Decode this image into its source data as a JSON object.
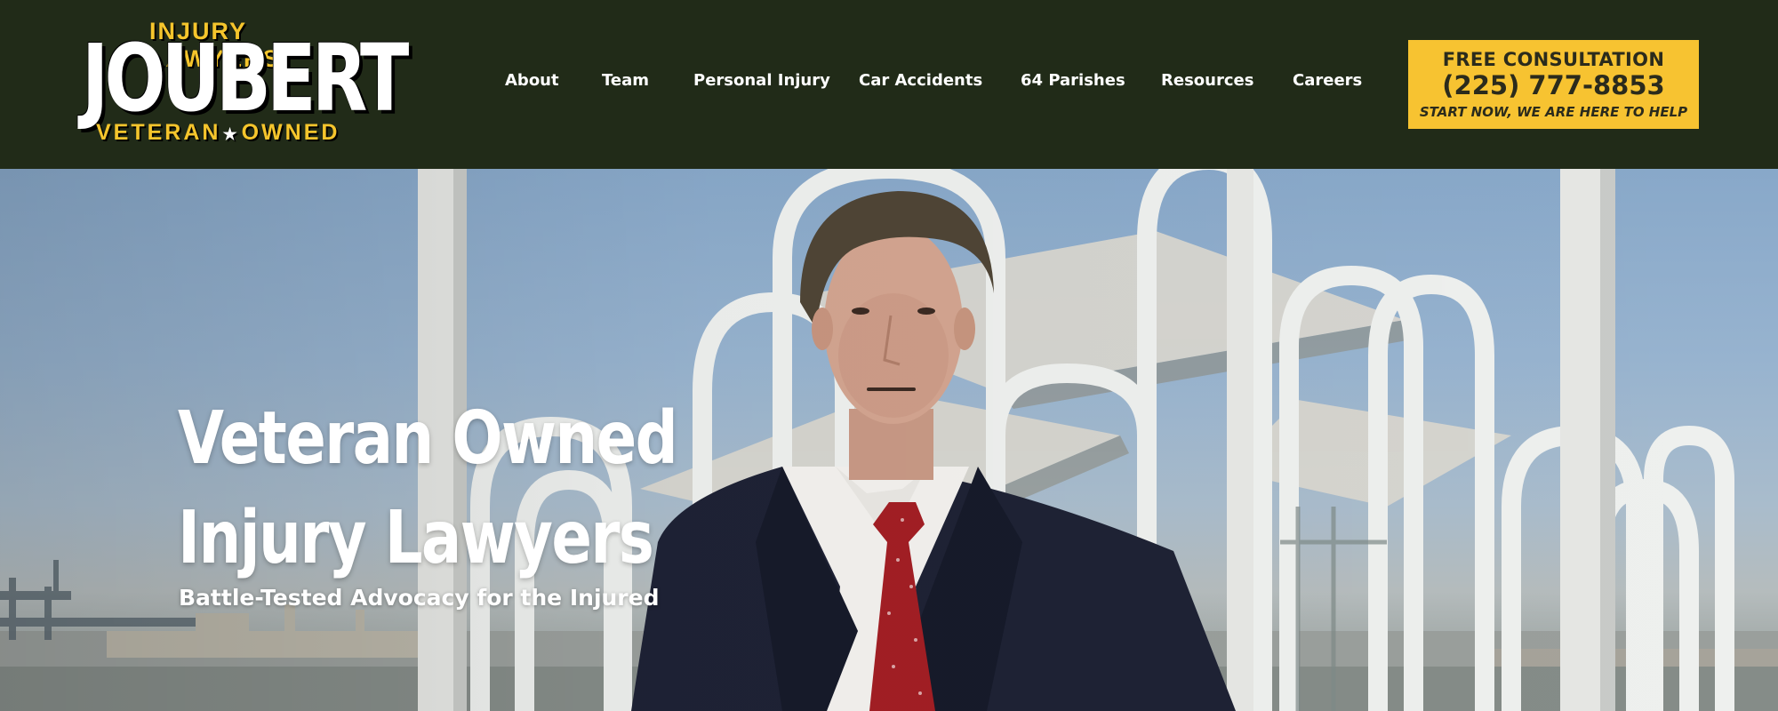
{
  "logo": {
    "top": "INJURY LAWYERS",
    "main": "JOUBERT",
    "bottom_left": "VETERAN",
    "bottom_right": "OWNED",
    "star_icon": "star-icon"
  },
  "nav": {
    "items": [
      {
        "label": "About"
      },
      {
        "label": "Team"
      },
      {
        "label": "Personal Injury"
      },
      {
        "label": "Car Accidents"
      },
      {
        "label": "64 Parishes"
      },
      {
        "label": "Resources"
      },
      {
        "label": "Careers"
      }
    ]
  },
  "cta": {
    "title": "FREE CONSULTATION",
    "phone": "(225) 777-8853",
    "subtitle": "START NOW, WE ARE HERE TO HELP"
  },
  "hero": {
    "title_line1": "Veteran Owned",
    "title_line2": "Injury Lawyers",
    "subtitle": "Battle-Tested Advocacy for the Injured"
  },
  "colors": {
    "header_bg": "#212b18",
    "accent_yellow": "#f7c331",
    "text_white": "#ffffff"
  }
}
